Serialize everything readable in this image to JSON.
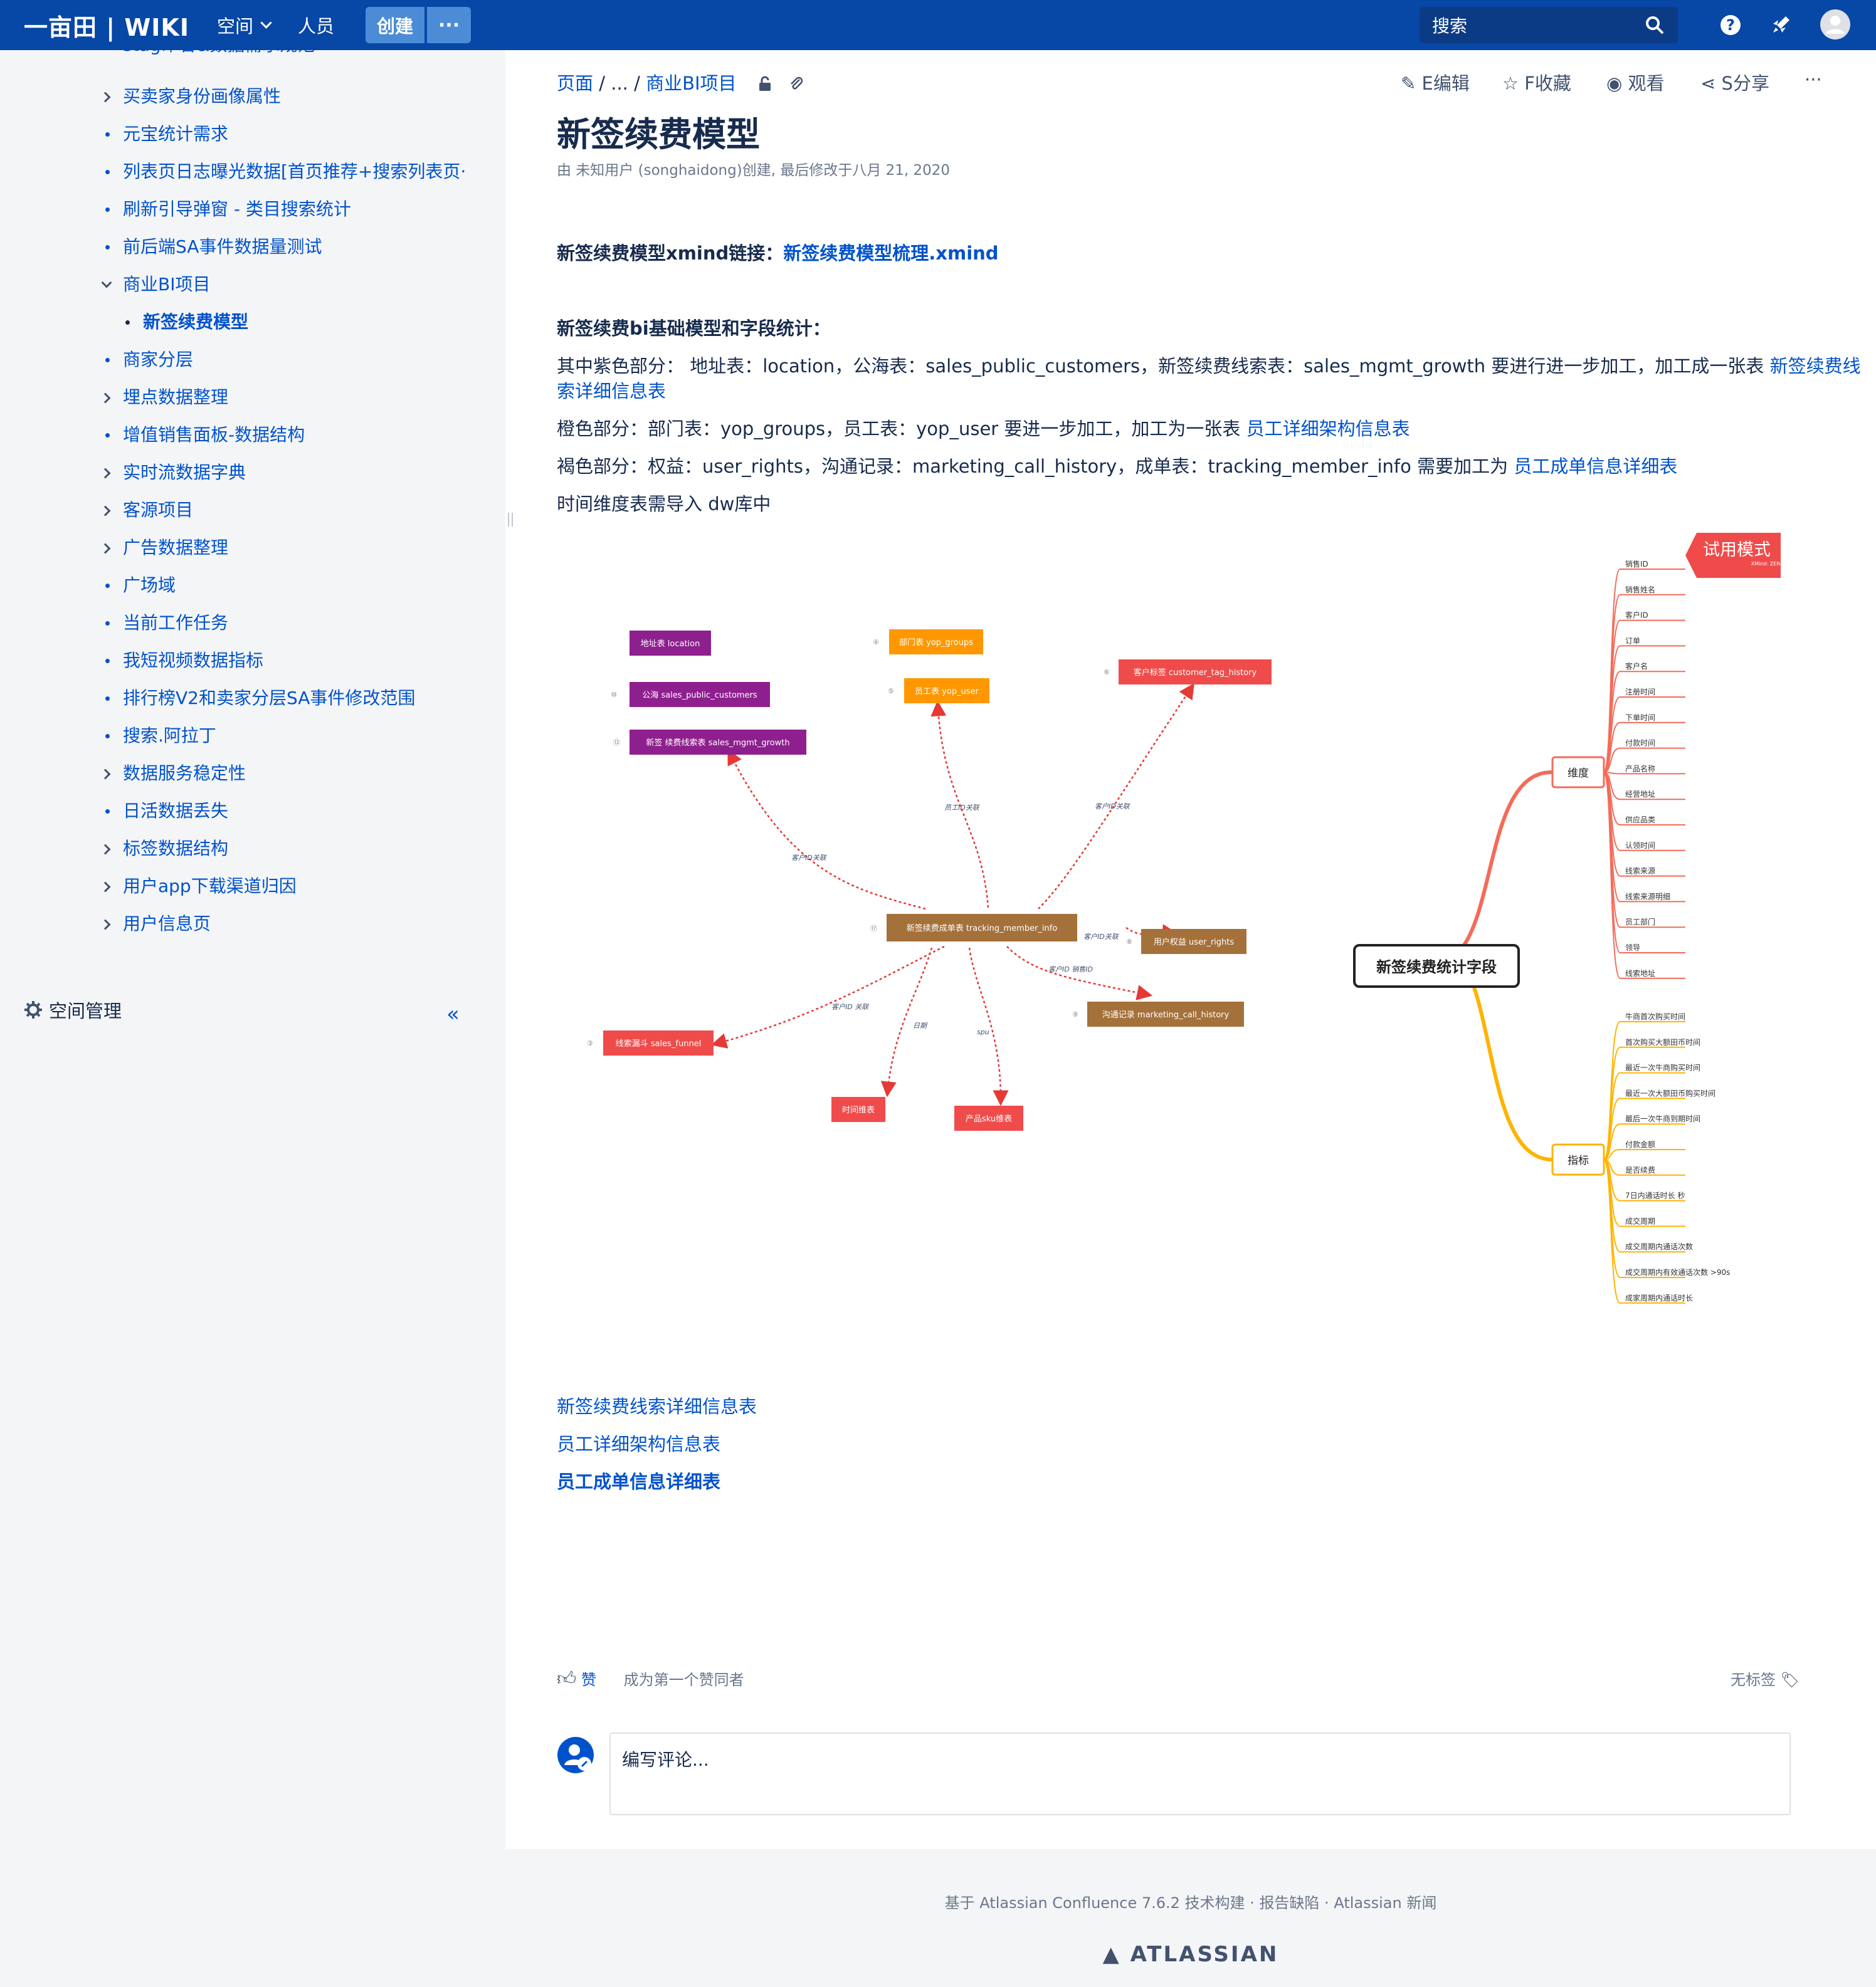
{
  "header": {
    "logo": "一亩田 | WIKI",
    "nav_spaces": "空间",
    "nav_people": "人员",
    "create": "创建",
    "more": "···",
    "search_placeholder": "搜索"
  },
  "sidebar": {
    "cut_top": "stag命名&数据需求规范",
    "items": [
      {
        "label": "买卖家身份画像属性",
        "kind": "chevron"
      },
      {
        "label": "元宝统计需求",
        "kind": "bullet"
      },
      {
        "label": "列表页日志曝光数据[首页推荐+搜索列表页·",
        "kind": "bullet"
      },
      {
        "label": "刷新引导弹窗 - 类目搜索统计",
        "kind": "bullet"
      },
      {
        "label": "前后端SA事件数据量测试",
        "kind": "bullet"
      },
      {
        "label": "商业BI项目",
        "kind": "expanded"
      },
      {
        "label": "新签续费模型",
        "kind": "current"
      },
      {
        "label": "商家分层",
        "kind": "bullet"
      },
      {
        "label": "埋点数据整理",
        "kind": "chevron"
      },
      {
        "label": "增值销售面板-数据结构",
        "kind": "bullet"
      },
      {
        "label": "实时流数据字典",
        "kind": "chevron"
      },
      {
        "label": "客源项目",
        "kind": "chevron"
      },
      {
        "label": "广告数据整理",
        "kind": "chevron"
      },
      {
        "label": "广场域",
        "kind": "bullet"
      },
      {
        "label": "当前工作任务",
        "kind": "bullet"
      },
      {
        "label": "我短视频数据指标",
        "kind": "bullet"
      },
      {
        "label": "排行榜V2和卖家分层SA事件修改范围",
        "kind": "bullet"
      },
      {
        "label": "搜索.阿拉丁",
        "kind": "bullet"
      },
      {
        "label": "数据服务稳定性",
        "kind": "chevron"
      },
      {
        "label": "日活数据丢失",
        "kind": "bullet"
      },
      {
        "label": "标签数据结构",
        "kind": "chevron"
      },
      {
        "label": "用户app下载渠道归因",
        "kind": "chevron"
      },
      {
        "label": "用户信息页",
        "kind": "chevron"
      }
    ],
    "space_admin": "空间管理"
  },
  "breadcrumb": {
    "root": "页面",
    "ellipsis": "...",
    "parent": "商业BI项目"
  },
  "actions": {
    "edit": "E编辑",
    "star": "F收藏",
    "watch": "观看",
    "share": "S分享",
    "more": "···"
  },
  "page": {
    "title": "新签续费模型",
    "meta": "由 未知用户 (songhaidong)创建, 最后修改于八月 21, 2020",
    "xmind_label": "新签续费模型xmind链接：",
    "xmind_link": "新签续费模型梳理.xmind",
    "section_title": "新签续费bi基础模型和字段统计：",
    "purple_text": "其中紫色部分：  地址表：location，公海表：sales_public_customers，新签续费线索表：sales_mgmt_growth  要进行进一步加工，加工成一张表",
    "purple_link_a": "新签续费线",
    "purple_link_b": "索详细信息表",
    "orange_text": "橙色部分：部门表：yop_groups，员工表：yop_user 要进一步加工，加工为一张表",
    "orange_link": "员工详细架构信息表",
    "brown_text": "褐色部分：权益：user_rights，沟通记录：marketing_call_history，成单表：tracking_member_info 需要加工为",
    "brown_link": "员工成单信息详细表",
    "time_text": "时间维度表需导入 dw库中",
    "bottom_links": [
      "新签续费线索详细信息表",
      "员工详细架构信息表",
      "员工成单信息详细表"
    ]
  },
  "diagram": {
    "trial_badge": "试用模式",
    "trial_sub": "XMind: ZEN",
    "center": "新签续费成单表 tracking_member_info",
    "nodes": {
      "location": "地址表 location",
      "public": "公海 sales_public_customers",
      "growth": "新签 续费线索表 sales_mgmt_growth",
      "groups": "部门表 yop_groups",
      "user": "员工表 yop_user",
      "tag": "客户标签 customer_tag_history",
      "rights": "用户权益 user_rights",
      "call": "沟通记录 marketing_call_history",
      "funnel": "线索漏斗 sales_funnel",
      "time": "时间维表",
      "sku": "产品sku维表"
    },
    "edges": {
      "cust1": "客户ID关联",
      "emp": "员工ID关联",
      "cust2": "客户ID关联",
      "cust3": "客户ID关联",
      "sale": "客户ID 销售ID",
      "cust4": "客户ID 关联",
      "date": "日期",
      "spu": "spu"
    },
    "num_badges": [
      "④",
      "⑤",
      "⑩",
      "⑬",
      "⑥",
      "⑰",
      "⑧",
      "⑨",
      "③"
    ],
    "root": "新签续费统计字段",
    "dim_label": "维度",
    "dims": [
      "销售ID",
      "销售姓名",
      "客户ID",
      "订单",
      "客户名",
      "注册时间",
      "下单时间",
      "付款时间",
      "产品名称",
      "经营地址",
      "供应品类",
      "认领时间",
      "线索来源",
      "线索来源明细",
      "员工部门",
      "领导",
      "线索地址"
    ],
    "metric_label": "指标",
    "metrics": [
      "牛商首次购买时间",
      "首次购买大额田币时间",
      "最近一次牛商购买时间",
      "最近一次大额田币购买时间",
      "最后一次牛商到期时间",
      "付款金额",
      "是否续费",
      "7日内通话时长 秒",
      "成交周期",
      "成交周期内通话次数",
      "成交周期内有效通话次数 >90s",
      "成家周期内通话时长"
    ]
  },
  "like": {
    "label": "赞",
    "first": "成为第一个赞同者",
    "no_labels": "无标签"
  },
  "comment": {
    "placeholder": "编写评论..."
  },
  "footer": {
    "links": "基于 Atlassian Confluence 7.6.2 技术构建  ·  报告缺陷  ·  Atlassian 新闻",
    "brand": "ATLASSIAN"
  },
  "colors": {
    "nav": "#0747a6",
    "link": "#0052cc",
    "purple": "#8e1f8e",
    "orange": "#ff9800",
    "brown": "#a5713b",
    "red": "#f04b4b",
    "root_line_dim": "#f46b5a",
    "root_line_metric": "#ffb300"
  }
}
